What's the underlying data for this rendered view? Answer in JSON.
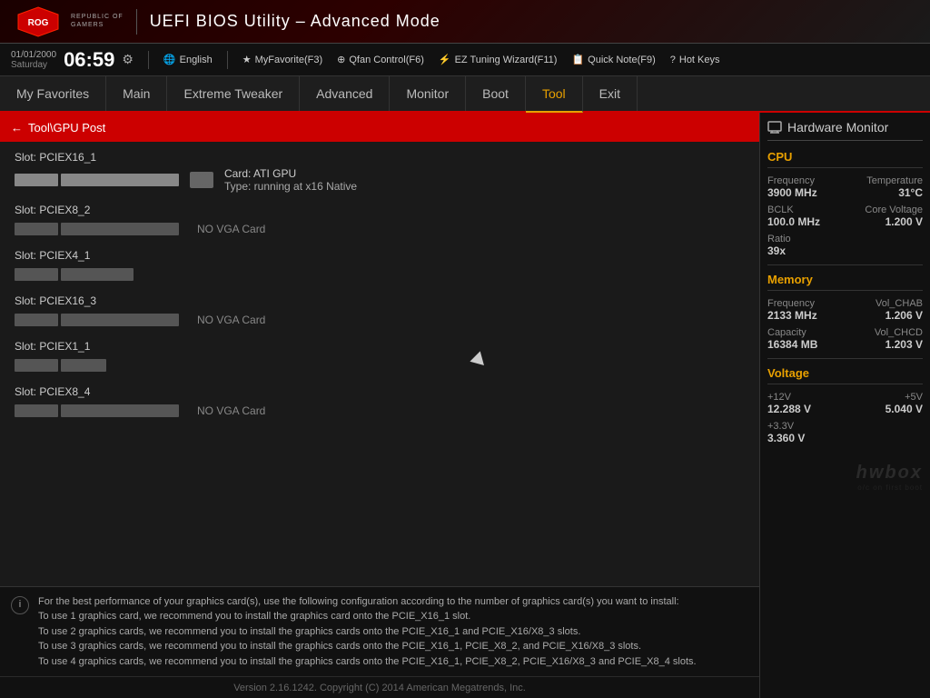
{
  "header": {
    "title": "UEFI BIOS Utility – Advanced Mode",
    "rog_line1": "REPUBLIC OF",
    "rog_line2": "GAMERS"
  },
  "toolbar": {
    "date": "01/01/2000",
    "day": "Saturday",
    "time": "06:59",
    "gear_icon": "⚙",
    "language": "English",
    "my_favorite": "MyFavorite(F3)",
    "qfan": "Qfan Control(F6)",
    "ez_tuning": "EZ Tuning Wizard(F11)",
    "quick_note": "Quick Note(F9)",
    "hot_keys": "Hot Keys"
  },
  "nav": {
    "items": [
      {
        "id": "my-favorites",
        "label": "My Favorites"
      },
      {
        "id": "main",
        "label": "Main"
      },
      {
        "id": "extreme-tweaker",
        "label": "Extreme Tweaker"
      },
      {
        "id": "advanced",
        "label": "Advanced"
      },
      {
        "id": "monitor",
        "label": "Monitor"
      },
      {
        "id": "boot",
        "label": "Boot"
      },
      {
        "id": "tool",
        "label": "Tool",
        "active": true
      },
      {
        "id": "exit",
        "label": "Exit"
      }
    ]
  },
  "breadcrumb": {
    "back_arrow": "←",
    "path": "Tool\\GPU Post"
  },
  "gpu_post": {
    "slots": [
      {
        "id": "pciex16_1",
        "label": "Slot: PCIEX16_1",
        "type": "x16",
        "active": true,
        "card_name": "Card: ATI GPU",
        "card_type": "Type: running at x16 Native",
        "no_vga": false
      },
      {
        "id": "pciex8_2",
        "label": "Slot: PCIEX8_2",
        "type": "x8",
        "active": false,
        "card_name": "",
        "card_type": "",
        "no_vga": true,
        "no_vga_text": "NO VGA Card"
      },
      {
        "id": "pciex4_1",
        "label": "Slot: PCIEX4_1",
        "type": "x4",
        "active": false,
        "card_name": "",
        "card_type": "",
        "no_vga": false
      },
      {
        "id": "pciex16_3",
        "label": "Slot: PCIEX16_3",
        "type": "x16",
        "active": false,
        "card_name": "",
        "card_type": "",
        "no_vga": true,
        "no_vga_text": "NO VGA Card"
      },
      {
        "id": "pciex1_1",
        "label": "Slot: PCIEX1_1",
        "type": "x1",
        "active": false,
        "card_name": "",
        "card_type": "",
        "no_vga": false
      },
      {
        "id": "pciex8_4",
        "label": "Slot: PCIEX8_4",
        "type": "x8",
        "active": false,
        "card_name": "",
        "card_type": "",
        "no_vga": true,
        "no_vga_text": "NO VGA Card"
      }
    ],
    "info_text": "For the best performance of your graphics card(s), use the following configuration according to the number of graphics card(s) you want to install:\nTo use 1 graphics card, we recommend you to install  the graphics card onto the PCIE_X16_1 slot.\nTo use 2 graphics cards, we recommend you to install the graphics cards onto the PCIE_X16_1 and PCIE_X16/X8_3 slots.\nTo use 3 graphics cards, we recommend you to install the graphics cards onto the PCIE_X16_1, PCIE_X8_2, and PCIE_X16/X8_3 slots.\nTo use 4 graphics cards, we recommend you to install the graphics cards onto the PCIE_X16_1, PCIE_X8_2, PCIE_X16/X8_3 and PCIE_X8_4 slots."
  },
  "hardware_monitor": {
    "title": "Hardware Monitor",
    "cpu": {
      "label": "CPU",
      "frequency_label": "Frequency",
      "frequency_value": "3900 MHz",
      "temperature_label": "Temperature",
      "temperature_value": "31°C",
      "bclk_label": "BCLK",
      "bclk_value": "100.0 MHz",
      "core_voltage_label": "Core Voltage",
      "core_voltage_value": "1.200 V",
      "ratio_label": "Ratio",
      "ratio_value": "39x"
    },
    "memory": {
      "label": "Memory",
      "frequency_label": "Frequency",
      "frequency_value": "2133 MHz",
      "vol_chab_label": "Vol_CHAB",
      "vol_chab_value": "1.206 V",
      "capacity_label": "Capacity",
      "capacity_value": "16384 MB",
      "vol_chcd_label": "Vol_CHCD",
      "vol_chcd_value": "1.203 V"
    },
    "voltage": {
      "label": "Voltage",
      "v12_label": "+12V",
      "v12_value": "12.288 V",
      "v5_label": "+5V",
      "v5_value": "5.040 V",
      "v33_label": "+3.3V",
      "v33_value": "3.360 V"
    }
  },
  "version": {
    "text": "Version 2.16.1242. Copyright (C) 2014 American Megatrends, Inc."
  }
}
